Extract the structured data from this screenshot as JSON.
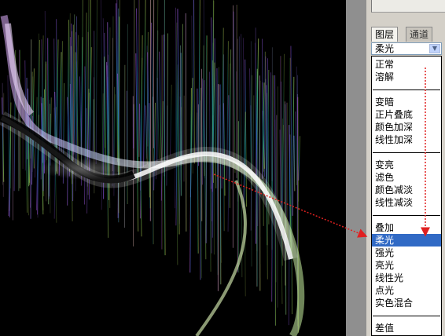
{
  "layers_panel": {
    "tabs": [
      {
        "label": "图层"
      },
      {
        "label": "通道"
      }
    ],
    "blend_mode": {
      "selected_value": "柔光",
      "dropdown_icon": "chevron-down-icon"
    },
    "blend_mode_options": [
      {
        "label": "正常"
      },
      {
        "label": "溶解"
      },
      {
        "label": "变暗"
      },
      {
        "label": "正片叠底"
      },
      {
        "label": "颜色加深"
      },
      {
        "label": "线性加深"
      },
      {
        "label": "变亮"
      },
      {
        "label": "滤色"
      },
      {
        "label": "颜色减淡"
      },
      {
        "label": "线性减淡"
      },
      {
        "label": "叠加"
      },
      {
        "label": "柔光",
        "selected": true
      },
      {
        "label": "强光"
      },
      {
        "label": "亮光"
      },
      {
        "label": "线性光"
      },
      {
        "label": "点光"
      },
      {
        "label": "实色混合"
      },
      {
        "label": "差值"
      }
    ]
  },
  "colors": {
    "selection": "#316ac5",
    "annotation_arrow": "#e02020",
    "canvas_background": "#000000",
    "panel_background": "#d4d0c8"
  }
}
